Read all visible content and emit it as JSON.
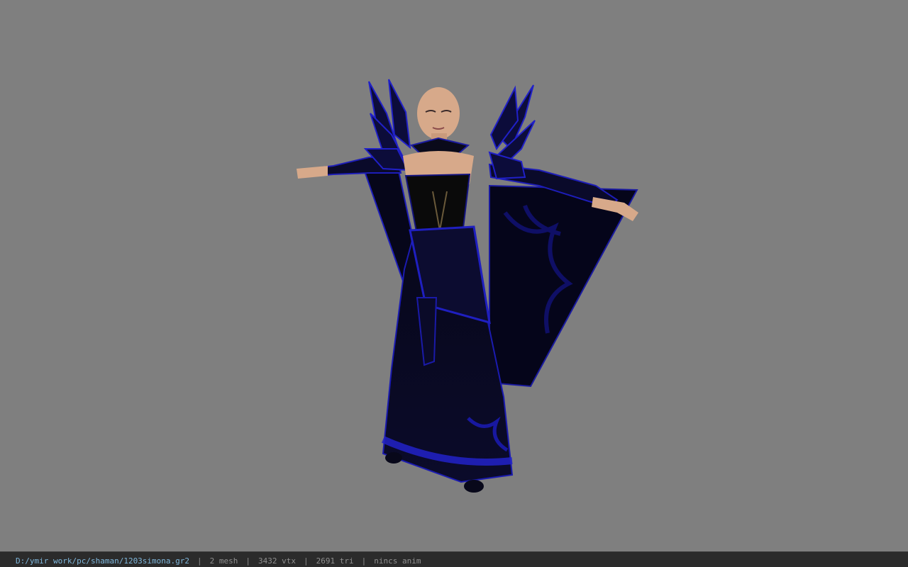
{
  "viewer": {
    "background_color": "#7f7f7f",
    "model": {
      "description_icon": "character-model",
      "colors": {
        "robe": "#0a0a18",
        "trim": "#1a1aa8",
        "skin": "#d7a98a"
      }
    }
  },
  "statusbar": {
    "file_path": "D:/ymir work/pc/shaman/1203simona.gr2",
    "separator": "|",
    "mesh_count": "2 mesh",
    "vertex_count": "3432 vtx",
    "triangle_count": "2691 tri",
    "anim_status": "nincs anim",
    "colors": {
      "path": "#7fb7dc",
      "text": "#8f8f8f",
      "background": "#2b2b2b"
    }
  }
}
